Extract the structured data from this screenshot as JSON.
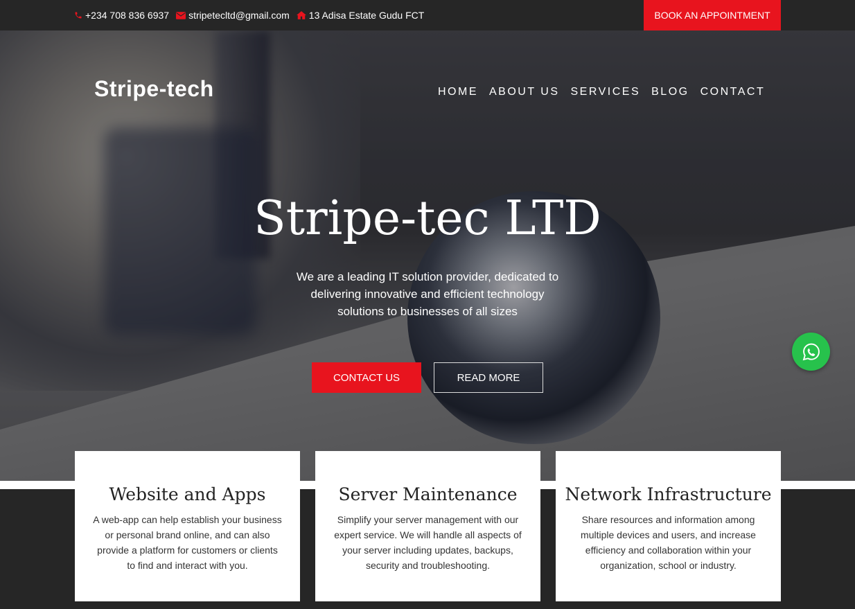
{
  "topbar": {
    "phone": "+234 708 836 6937",
    "email": "stripetecltd@gmail.com",
    "address": "13 Adisa Estate Gudu FCT",
    "book_label": "BOOK AN APPOINTMENT"
  },
  "header": {
    "logo": "Stripe-tech",
    "nav": [
      "HOME",
      "ABOUT US",
      "SERVICES",
      "BLOG",
      "CONTACT"
    ]
  },
  "hero": {
    "title": "Stripe-tec LTD",
    "text": "We are a leading IT solution provider, dedicated to delivering innovative and efficient technology solutions to businesses of all sizes",
    "contact_label": "CONTACT US",
    "read_label": "READ MORE"
  },
  "cards": [
    {
      "title": "Website and Apps",
      "text": "A web-app can help establish your business or personal brand online, and can also provide a platform for customers or clients to find and interact with you."
    },
    {
      "title": "Server Maintenance",
      "text": "Simplify your server management with our expert service. We will handle all aspects of your server including updates, backups, security and troubleshooting."
    },
    {
      "title": "Network Infrastructure",
      "text": "Share resources and information among multiple devices and users, and increase efficiency and collaboration within your organization, school or industry."
    }
  ],
  "colors": {
    "accent": "#e8141e",
    "dark": "#262626",
    "whatsapp": "#27c24c"
  },
  "icons": {
    "phone": "phone-icon",
    "email": "envelope-icon",
    "address": "home-icon",
    "chat": "whatsapp-icon"
  }
}
